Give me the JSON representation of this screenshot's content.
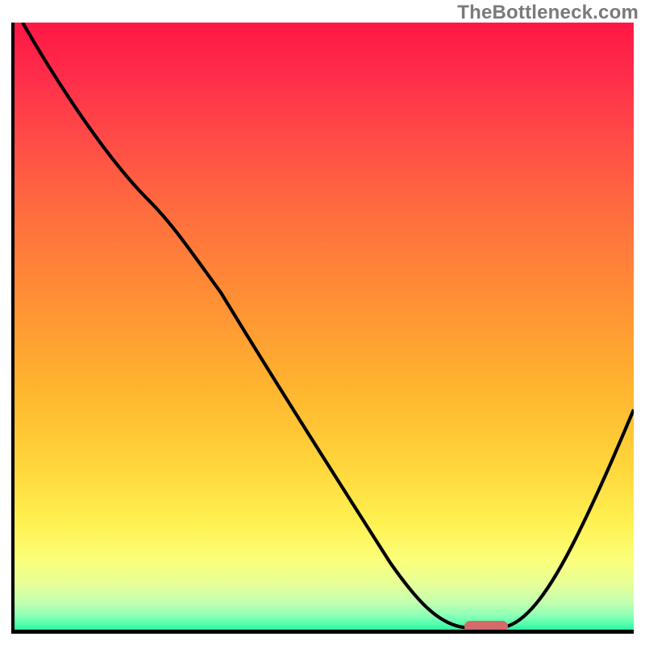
{
  "watermark": "TheBottleneck.com",
  "chart_data": {
    "type": "line",
    "title": "",
    "xlabel": "",
    "ylabel": "",
    "xlim": [
      0,
      100
    ],
    "ylim": [
      0,
      100
    ],
    "background_gradient": {
      "top_color": "#ff1744",
      "bottom_color": "#19e58f",
      "stops": [
        {
          "pos": 0.0,
          "color": "#ff1744"
        },
        {
          "pos": 0.3,
          "color": "#ff6a3f"
        },
        {
          "pos": 0.6,
          "color": "#ffb52f"
        },
        {
          "pos": 0.82,
          "color": "#fff152"
        },
        {
          "pos": 0.95,
          "color": "#c0ffb0"
        },
        {
          "pos": 1.0,
          "color": "#19e58f"
        }
      ]
    },
    "series": [
      {
        "name": "bottleneck-curve",
        "color": "#000000",
        "x": [
          2,
          10,
          22,
          34,
          46,
          58,
          70,
          74,
          79,
          84,
          90,
          95,
          100
        ],
        "y": [
          100,
          83,
          70,
          55,
          40,
          25,
          10,
          3,
          1,
          1,
          8,
          22,
          37
        ]
      }
    ],
    "markers": [
      {
        "name": "optimal-range",
        "shape": "pill",
        "color": "#d46a6a",
        "x_start": 73,
        "x_end": 80,
        "y": 1
      }
    ],
    "ticks": {
      "x": [],
      "y": []
    },
    "legend": null
  }
}
